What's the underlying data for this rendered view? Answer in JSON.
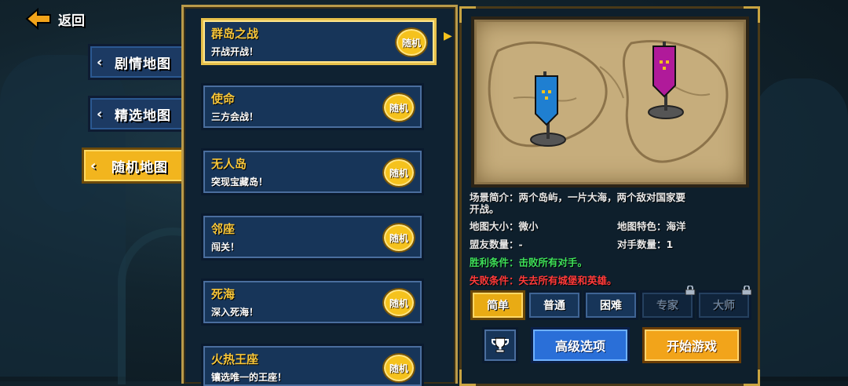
{
  "nav": {
    "back_label": "返回"
  },
  "tabs": [
    {
      "label": "剧情地图"
    },
    {
      "label": "精选地图"
    },
    {
      "label": "随机地图"
    }
  ],
  "levels": [
    {
      "title": "群岛之战",
      "subtitle": "开战开战！",
      "random_label": "随机"
    },
    {
      "title": "使命",
      "subtitle": "三方会战！",
      "random_label": "随机"
    },
    {
      "title": "无人岛",
      "subtitle": "突现宝藏岛！",
      "random_label": "随机"
    },
    {
      "title": "邻座",
      "subtitle": "闯关！",
      "random_label": "随机"
    },
    {
      "title": "死海",
      "subtitle": "深入死海！",
      "random_label": "随机"
    },
    {
      "title": "火热王座",
      "subtitle": "镶选唯一的王座！",
      "random_label": "随机"
    }
  ],
  "details": {
    "scene_desc_line1": "场景简介：两个岛屿，一片大海，两个敌对国家要",
    "scene_desc_line2": "开战。",
    "map_size": "地图大小：微小",
    "map_feature": "地图特色：海洋",
    "allies": "盟友数量：-",
    "opponents": "对手数量：1",
    "win_condition": "胜利条件：击败所有对手。",
    "lose_condition": "失败条件：失去所有城堡和英雄。"
  },
  "difficulty": [
    {
      "label": "简单",
      "state": "active"
    },
    {
      "label": "普通",
      "state": "normal"
    },
    {
      "label": "困难",
      "state": "normal"
    },
    {
      "label": "专家",
      "state": "locked"
    },
    {
      "label": "大师",
      "state": "locked"
    }
  ],
  "actions": {
    "advanced_label": "高级选项",
    "start_label": "开始游戏"
  },
  "colors": {
    "accent_gold": "#f5c21d",
    "panel_blue": "#173559",
    "win_green": "#3ee05a",
    "lose_red": "#ff3b3b",
    "team_blue": "#1f7fd1",
    "team_purple": "#b01a9a"
  }
}
